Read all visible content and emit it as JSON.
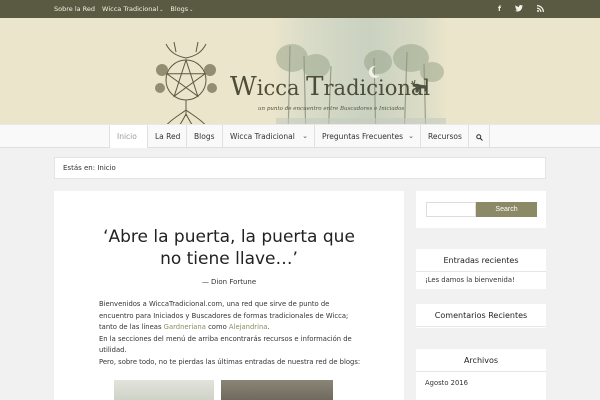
{
  "topbar": {
    "links": [
      "Sobre la Red",
      "Wicca Tradicional",
      "Blogs"
    ],
    "social_icons": [
      "facebook-icon",
      "twitter-icon",
      "rss-icon"
    ]
  },
  "header": {
    "title_w": "W",
    "title_icca": "icca ",
    "title_t": "T",
    "title_radicional": "radicional",
    "tagline": "un punto de encuentro entre Buscadores e Iniciados"
  },
  "nav": {
    "items": [
      "Inicio",
      "La Red",
      "Blogs",
      "Wicca Tradicional",
      "Preguntas Frecuentes",
      "Recursos"
    ],
    "search_icon": "search-icon"
  },
  "breadcrumb": {
    "prefix": "Estás en:",
    "current": "Inicio"
  },
  "main": {
    "quote_line1": "‘Abre la puerta, la puerta que",
    "quote_line2": "no tiene llave…’",
    "author": "— Dion Fortune",
    "p1": "Bienvenidos a WiccaTradicional.com, una red que sirve de punto de",
    "p2": "encuentro para Iniciados y Buscadores de formas tradicionales de Wicca;",
    "p3a": "tanto de las líneas ",
    "link1": "Gardneriana",
    "p3b": " como ",
    "link2": "Alejandrina",
    "p3c": ".",
    "p4": "En la secciones del menú de arriba encontrarás recursos e información de",
    "p5": "utilidad.",
    "p6": "Pero, sobre todo, no te pierdas las últimas entradas de nuestra red de blogs:"
  },
  "sidebar": {
    "search_button": "Search",
    "search_placeholder": "",
    "recent_title": "Entradas recientes",
    "recent_items": [
      "¡Les damos la bienvenida!"
    ],
    "comments_title": "Comentarios Recientes",
    "archive_title": "Archivos",
    "archive_items": [
      "Agosto 2016"
    ]
  },
  "colors": {
    "topbar": "#5a5a42",
    "accent": "#8c8967",
    "header_bg": "#ebe5cb"
  }
}
